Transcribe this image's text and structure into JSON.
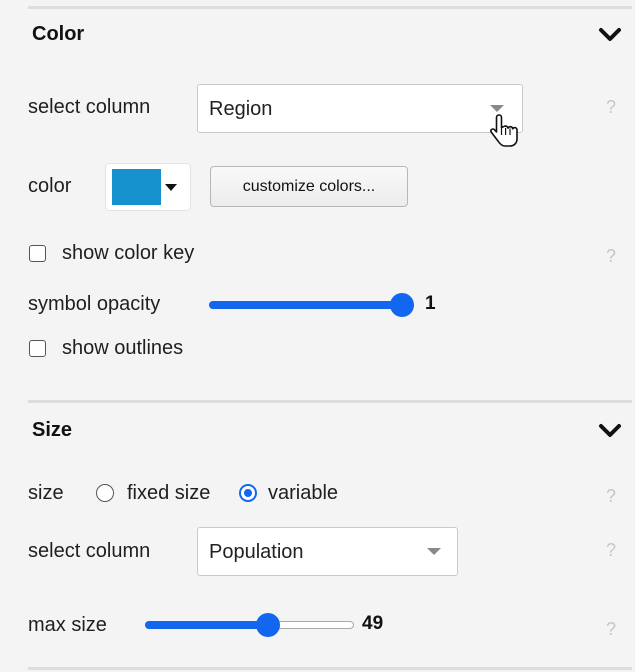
{
  "color_section": {
    "title": "Color",
    "select_column_label": "select column",
    "select_column_value": "Region",
    "color_label": "color",
    "swatch_color": "#1591cd",
    "customize_button": "customize colors...",
    "show_color_key_label": "show color key",
    "show_color_key_checked": false,
    "symbol_opacity_label": "symbol opacity",
    "symbol_opacity_value": "1",
    "symbol_opacity_fraction": 1.0,
    "show_outlines_label": "show outlines",
    "show_outlines_checked": false
  },
  "size_section": {
    "title": "Size",
    "size_label": "size",
    "fixed_size_label": "fixed size",
    "variable_label": "variable",
    "selected_mode": "variable",
    "select_column_label": "select column",
    "select_column_value": "Population",
    "max_size_label": "max size",
    "max_size_value": "49",
    "max_size_fraction": 0.6
  },
  "help_glyph": "?",
  "icons": {
    "collapse": "chevron-down-icon",
    "dropdown": "caret-down-icon",
    "pointer": "hand-pointer-cursor-icon"
  },
  "colors": {
    "accent": "#1266f0",
    "panel_bg": "#f4f4f4",
    "help": "#c6c6c6"
  }
}
